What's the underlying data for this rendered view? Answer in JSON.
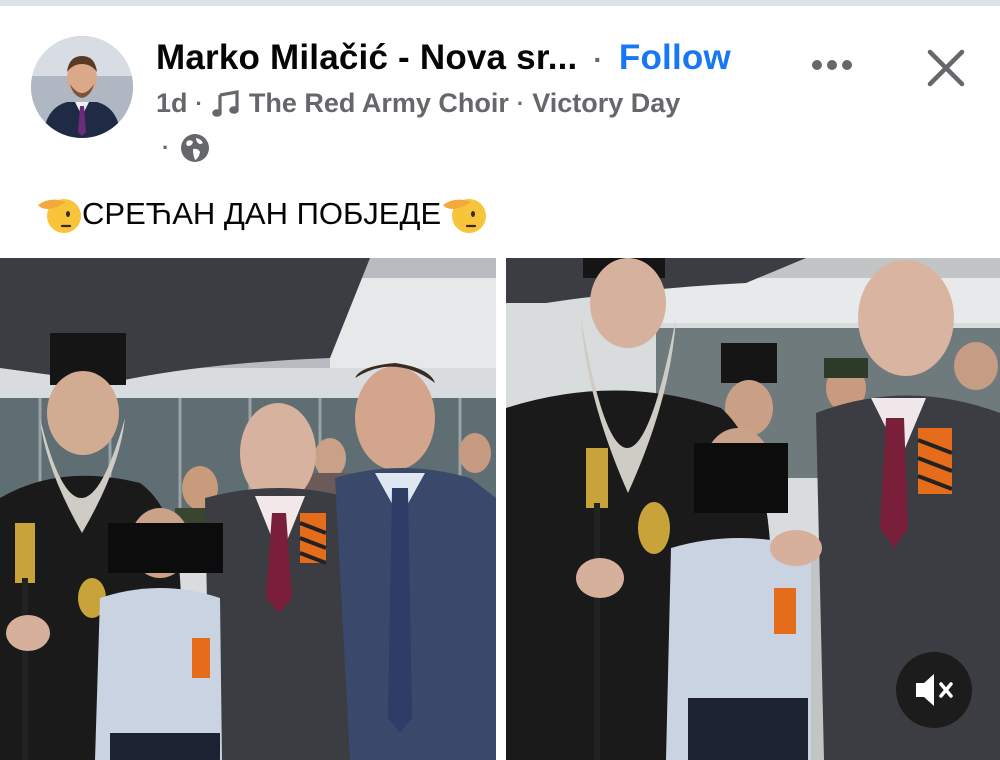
{
  "post": {
    "author": "Marko Milačić - Nova sr...",
    "separator": "·",
    "follow_label": "Follow",
    "time": "1d",
    "music_title": "The Red Army Choir",
    "activity": "Victory Day",
    "caption_text": "СРЕЋАН ДАН ПОБЈЕДЕ"
  },
  "icons": {
    "music": "music-note-icon",
    "privacy": "globe-icon",
    "more": "more-dots-icon",
    "close": "close-icon",
    "salute": "saluting-face-emoji",
    "mute": "speaker-muted-icon"
  },
  "colors": {
    "accent": "#1877f2",
    "secondary_text": "#65676b",
    "primary_text": "#050505"
  }
}
